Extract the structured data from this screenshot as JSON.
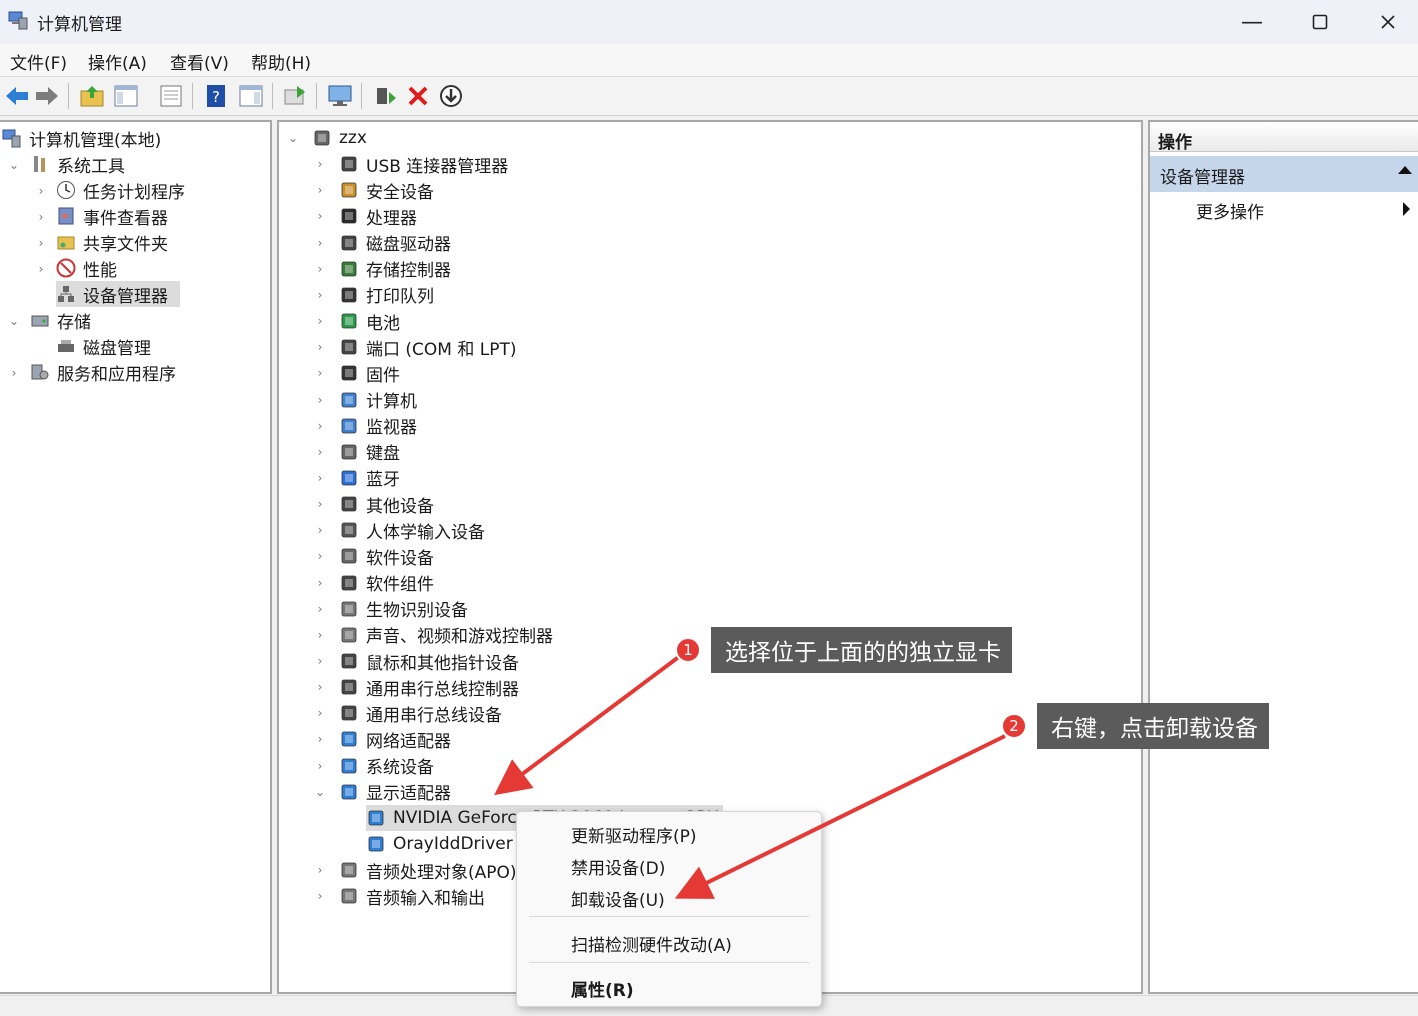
{
  "window": {
    "title": "计算机管理",
    "minimize_icon": "minimize-icon",
    "maximize_icon": "maximize-icon",
    "close_icon": "close-icon"
  },
  "menu": [
    "文件(F)",
    "操作(A)",
    "查看(V)",
    "帮助(H)"
  ],
  "toolbar": [
    "back-arrow-icon",
    "forward-arrow-icon",
    "up-folder-icon",
    "show-hide-console-tree-icon",
    "properties-icon",
    "help-icon",
    "show-action-pane-icon",
    "export-icon",
    "display-monitor-icon",
    "update-driver-icon",
    "uninstall-x-icon",
    "scan-hardware-icon"
  ],
  "tree": [
    {
      "label": "计算机管理(本地)",
      "level": 0
    },
    {
      "label": "系统工具",
      "level": 1,
      "expanded": true
    },
    {
      "label": "任务计划程序",
      "level": 2
    },
    {
      "label": "事件查看器",
      "level": 2
    },
    {
      "label": "共享文件夹",
      "level": 2
    },
    {
      "label": "性能",
      "level": 2
    },
    {
      "label": "设备管理器",
      "level": 2,
      "selected": true
    },
    {
      "label": "存储",
      "level": 1,
      "expanded": true
    },
    {
      "label": "磁盘管理",
      "level": 2
    },
    {
      "label": "服务和应用程序",
      "level": 1
    }
  ],
  "devices": {
    "root": "zzx",
    "categories": [
      "USB 连接器管理器",
      "安全设备",
      "处理器",
      "磁盘驱动器",
      "存储控制器",
      "打印队列",
      "电池",
      "端口 (COM 和 LPT)",
      "固件",
      "计算机",
      "监视器",
      "键盘",
      "蓝牙",
      "其他设备",
      "人体学输入设备",
      "软件设备",
      "软件组件",
      "生物识别设备",
      "声音、视频和游戏控制器",
      "鼠标和其他指针设备",
      "通用串行总线控制器",
      "通用串行总线设备",
      "网络适配器",
      "系统设备",
      "显示适配器"
    ],
    "display_children": [
      "NVIDIA GeForce RTX 3060 Laptop GPU",
      "OrayIddDriver Device"
    ],
    "after": [
      "音频处理对象(APO)",
      "音频输入和输出"
    ]
  },
  "actions": {
    "header": "操作",
    "section": "设备管理器",
    "more": "更多操作"
  },
  "context_menu": {
    "items": [
      "更新驱动程序(P)",
      "禁用设备(D)",
      "卸载设备(U)"
    ],
    "scan": "扫描检测硬件改动(A)",
    "properties": "属性(R)"
  },
  "annotations": [
    {
      "num": "1",
      "text": "选择位于上面的的独立显卡"
    },
    {
      "num": "2",
      "text": "右键，点击卸载设备"
    }
  ],
  "colors": {
    "selection": "#dcdcdc",
    "actions_section": "#c5d5ea",
    "callout": "#5b5b5b",
    "badge": "#e53935",
    "arrow": "#e53935"
  }
}
